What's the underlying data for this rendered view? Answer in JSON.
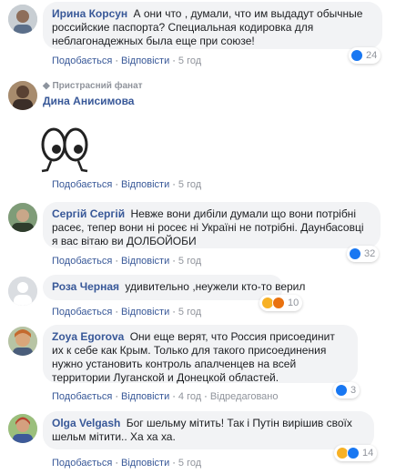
{
  "labels": {
    "like": "Подобається",
    "reply": "Відповісти",
    "dot": "·",
    "replied": "Відредаговано"
  },
  "comments": [
    {
      "author": "Ирина Корсун",
      "text": "А они что , думали, что им выдадут обычные российские паспорта? Специальная кодировка для неблагонадежных была еще при союзе!",
      "time": "5 год",
      "reactions": "24"
    },
    {
      "badge": "Пристрасний фанат",
      "author": "Дина Анисимова",
      "time": "5 год"
    },
    {
      "author": "Сергій Сергій",
      "text": "Невже вони дибіли думали що вони потрібні расеє, тепер вони ні росеє ні Україні не потрібні. Даунбасовці я вас вітаю ви ДОЛБОЙОБИ",
      "time": "5 год",
      "reactions": "32"
    },
    {
      "author": "Роза Черная",
      "text": "удивительно ,неужели кто-то верил",
      "time": "5 год",
      "reactions": "10"
    },
    {
      "author": "Zoya Egorova",
      "text": "Они еще верят, что Россия присоединит их к себе как Крым. Только для такого присоединения нужно установить контроль апалченцев на всей территории Луганской и Донецкой областей.",
      "time": "4 год",
      "reactions": "3"
    },
    {
      "author": "Olga Velgash",
      "text": "Бог шельму мітить! Так і Путін вирішив своїх шельм мітити.. Ха ха ха.",
      "time": "5 год",
      "reactions": "14"
    }
  ]
}
